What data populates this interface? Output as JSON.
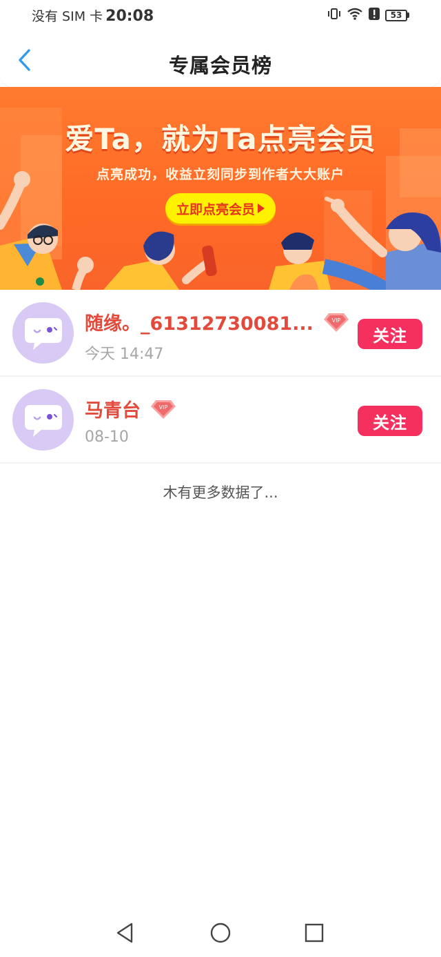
{
  "status_bar": {
    "carrier": "没有 SIM 卡",
    "time": "20:08",
    "battery": "53",
    "icons": [
      "vibrate-icon",
      "wifi-icon",
      "alert-icon",
      "battery-icon"
    ]
  },
  "header": {
    "title": "专属会员榜",
    "back_icon": "chevron-left-icon"
  },
  "banner": {
    "title": "爱Ta，就为Ta点亮会员",
    "subtitle": "点亮成功，收益立刻同步到作者大大账户",
    "cta_label": "立即点亮会员"
  },
  "members": [
    {
      "name": "随缘。_61312730081...",
      "time": "今天 14:47",
      "badge": "VIP",
      "follow_label": "关注"
    },
    {
      "name": "马青台",
      "time": "08-10",
      "badge": "VIP",
      "follow_label": "关注"
    }
  ],
  "footer_text": "木有更多数据了...",
  "nav": [
    "back-triangle-icon",
    "home-circle-icon",
    "recents-square-icon"
  ],
  "colors": {
    "accent_blue": "#2f9bf0",
    "banner_orange": "#ff6a26",
    "cta_yellow": "#fff200",
    "name_red": "#e24a3b",
    "follow_pink": "#f5305f",
    "avatar_lilac": "#d9c9f5"
  }
}
